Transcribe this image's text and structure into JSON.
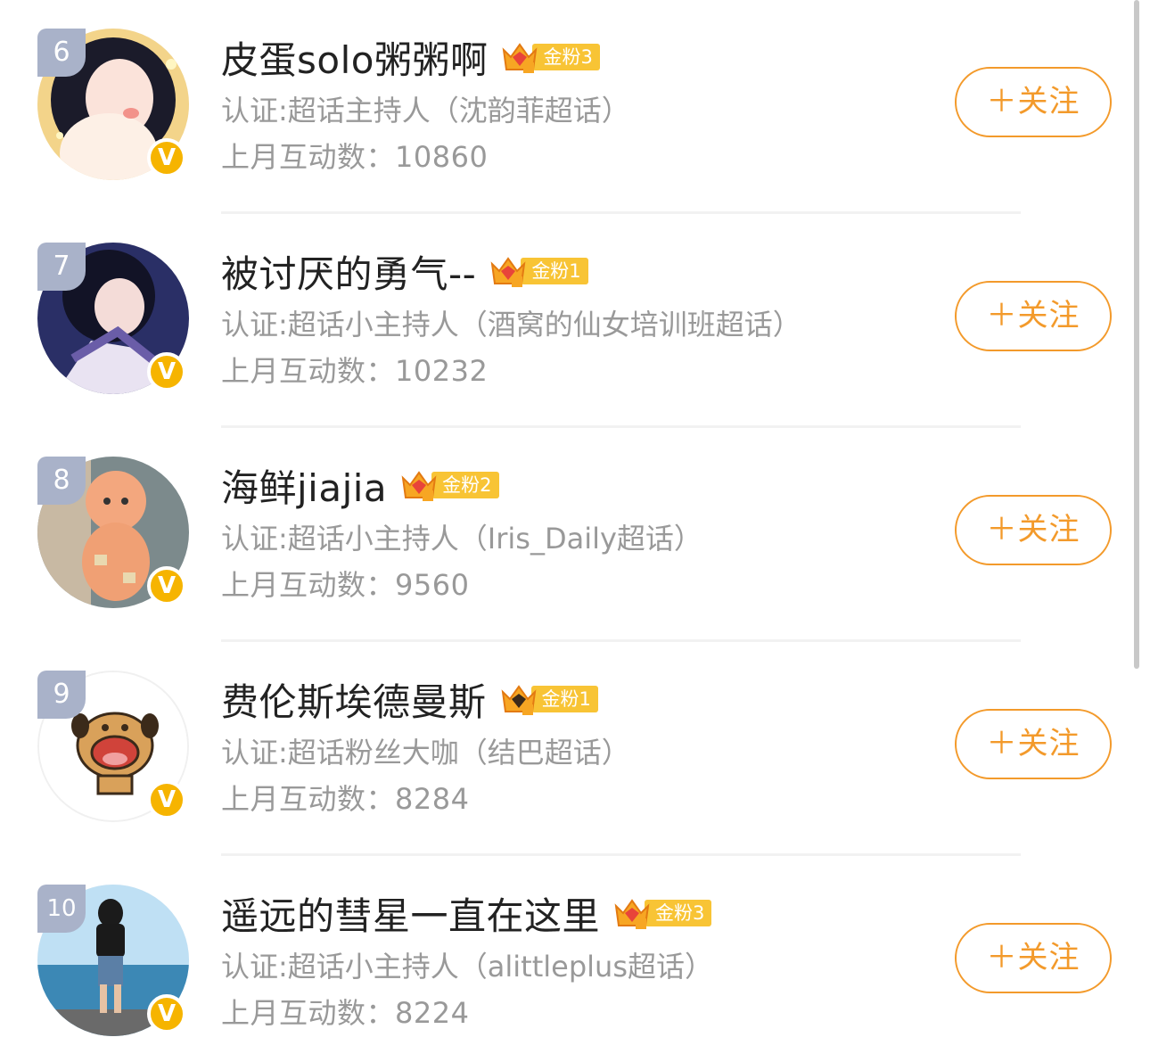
{
  "rows": [
    {
      "rank": "6",
      "name": "皮蛋solo粥粥啊",
      "fan_level": "金粉3",
      "cert": "认证:超话主持人（沈韵菲超话）",
      "interact": "上月互动数：10860",
      "follow_label": "＋关注"
    },
    {
      "rank": "7",
      "name": "被讨厌的勇气--",
      "fan_level": "金粉1",
      "cert": "认证:超话小主持人（酒窝的仙女培训班超话）",
      "interact": "上月互动数：10232",
      "follow_label": "＋关注"
    },
    {
      "rank": "8",
      "name": "海鲜jiajia",
      "fan_level": "金粉2",
      "cert": "认证:超话小主持人（Iris_Daily超话）",
      "interact": "上月互动数：9560",
      "follow_label": "＋关注"
    },
    {
      "rank": "9",
      "name": "费伦斯埃德曼斯",
      "fan_level": "金粉1",
      "cert": "认证:超话粉丝大咖（结巴超话）",
      "interact": "上月互动数：8284",
      "follow_label": "＋关注"
    },
    {
      "rank": "10",
      "name": "遥远的彗星一直在这里",
      "fan_level": "金粉3",
      "cert": "认证:超话小主持人（alittleplus超话）",
      "interact": "上月互动数：8224",
      "follow_label": "＋关注"
    }
  ],
  "verified_badge": "V",
  "colors": {
    "accent": "#f39a2b",
    "fan_badge": "#f8c435",
    "rank_badge": "#a9b2c9",
    "verified": "#f6b400"
  }
}
